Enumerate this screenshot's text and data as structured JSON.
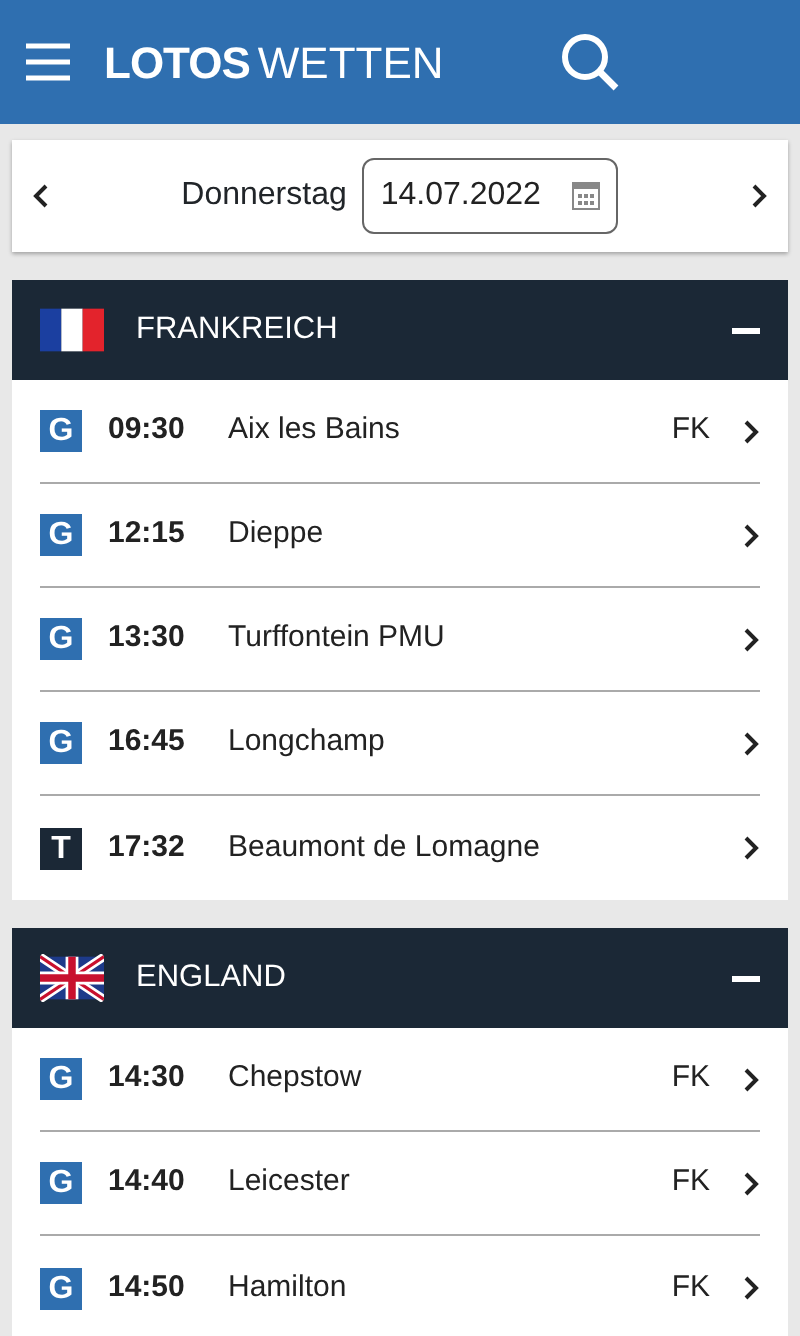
{
  "header": {
    "logo_bold": "LOTOS",
    "logo_light": "WETTEN"
  },
  "date_bar": {
    "weekday": "Donnerstag",
    "date": "14.07.2022"
  },
  "sections": [
    {
      "country": "FRANKREICH",
      "kind": "france",
      "expanded": true,
      "races": [
        {
          "badge": "G",
          "color": "#2f6fb0",
          "time": "09:30",
          "venue": "Aix les Bains",
          "tag": "FK"
        },
        {
          "badge": "G",
          "color": "#2f6fb0",
          "time": "12:15",
          "venue": "Dieppe"
        },
        {
          "badge": "G",
          "color": "#2f6fb0",
          "time": "13:30",
          "venue": "Turffontein PMU"
        },
        {
          "badge": "G",
          "color": "#2f6fb0",
          "time": "16:45",
          "venue": "Longchamp"
        },
        {
          "badge": "T",
          "color": "#1b2836",
          "time": "17:32",
          "venue": "Beaumont de Lomagne"
        }
      ]
    },
    {
      "country": "ENGLAND",
      "kind": "uk",
      "expanded": true,
      "races": [
        {
          "badge": "G",
          "color": "#2f6fb0",
          "time": "14:30",
          "venue": "Chepstow",
          "tag": "FK"
        },
        {
          "badge": "G",
          "color": "#2f6fb0",
          "time": "14:40",
          "venue": "Leicester",
          "tag": "FK"
        },
        {
          "badge": "G",
          "color": "#2f6fb0",
          "time": "14:50",
          "venue": "Hamilton",
          "tag": "FK"
        }
      ]
    }
  ]
}
